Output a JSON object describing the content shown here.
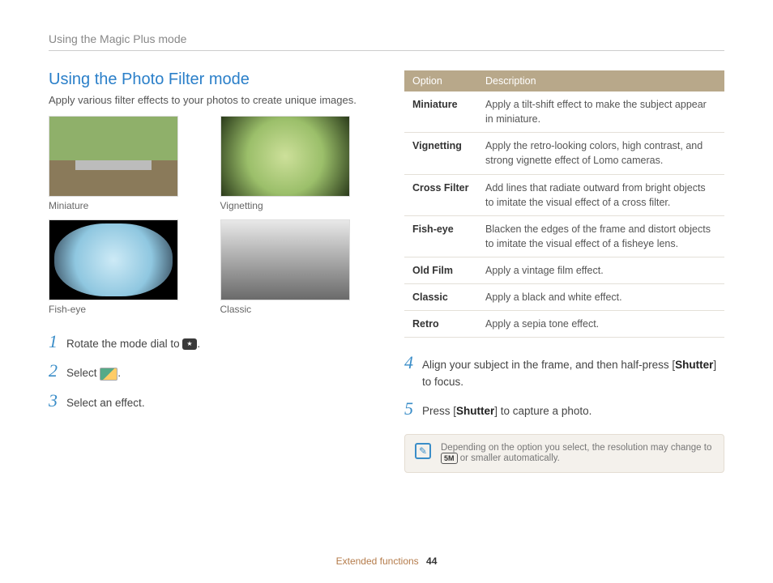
{
  "page_header": "Using the Magic Plus mode",
  "section": {
    "title": "Using the Photo Filter mode",
    "desc": "Apply various filter effects to your photos to create unique images."
  },
  "thumbnails": [
    {
      "caption": "Miniature"
    },
    {
      "caption": "Vignetting"
    },
    {
      "caption": "Fish-eye"
    },
    {
      "caption": "Classic"
    }
  ],
  "steps_left": [
    {
      "num": "1",
      "pre": "Rotate the mode dial to ",
      "post": "."
    },
    {
      "num": "2",
      "pre": "Select ",
      "post": "."
    },
    {
      "num": "3",
      "pre": "Select an effect.",
      "post": ""
    }
  ],
  "steps_right": [
    {
      "num": "4",
      "pre": "Align your subject in the frame, and then half-press [",
      "bold": "Shutter",
      "post": "] to focus."
    },
    {
      "num": "5",
      "pre": "Press [",
      "bold": "Shutter",
      "post": "] to capture a photo."
    }
  ],
  "table": {
    "headers": {
      "option": "Option",
      "desc": "Description"
    },
    "rows": [
      {
        "name": "Miniature",
        "desc": "Apply a tilt-shift effect to make the subject appear in miniature."
      },
      {
        "name": "Vignetting",
        "desc": "Apply the retro-looking colors, high contrast, and strong vignette effect of Lomo cameras."
      },
      {
        "name": "Cross Filter",
        "desc": "Add lines that radiate outward from bright objects to imitate the visual effect of a cross filter."
      },
      {
        "name": "Fish-eye",
        "desc": "Blacken the edges of the frame and distort objects to imitate the visual effect of a fisheye lens."
      },
      {
        "name": "Old Film",
        "desc": "Apply a vintage film effect."
      },
      {
        "name": "Classic",
        "desc": "Apply a black and white effect."
      },
      {
        "name": "Retro",
        "desc": "Apply a sepia tone effect."
      }
    ]
  },
  "note": {
    "pre": "Depending on the option you select, the resolution may change to ",
    "badge": "5M",
    "post": " or smaller automatically."
  },
  "footer": {
    "section": "Extended functions",
    "page": "44"
  }
}
